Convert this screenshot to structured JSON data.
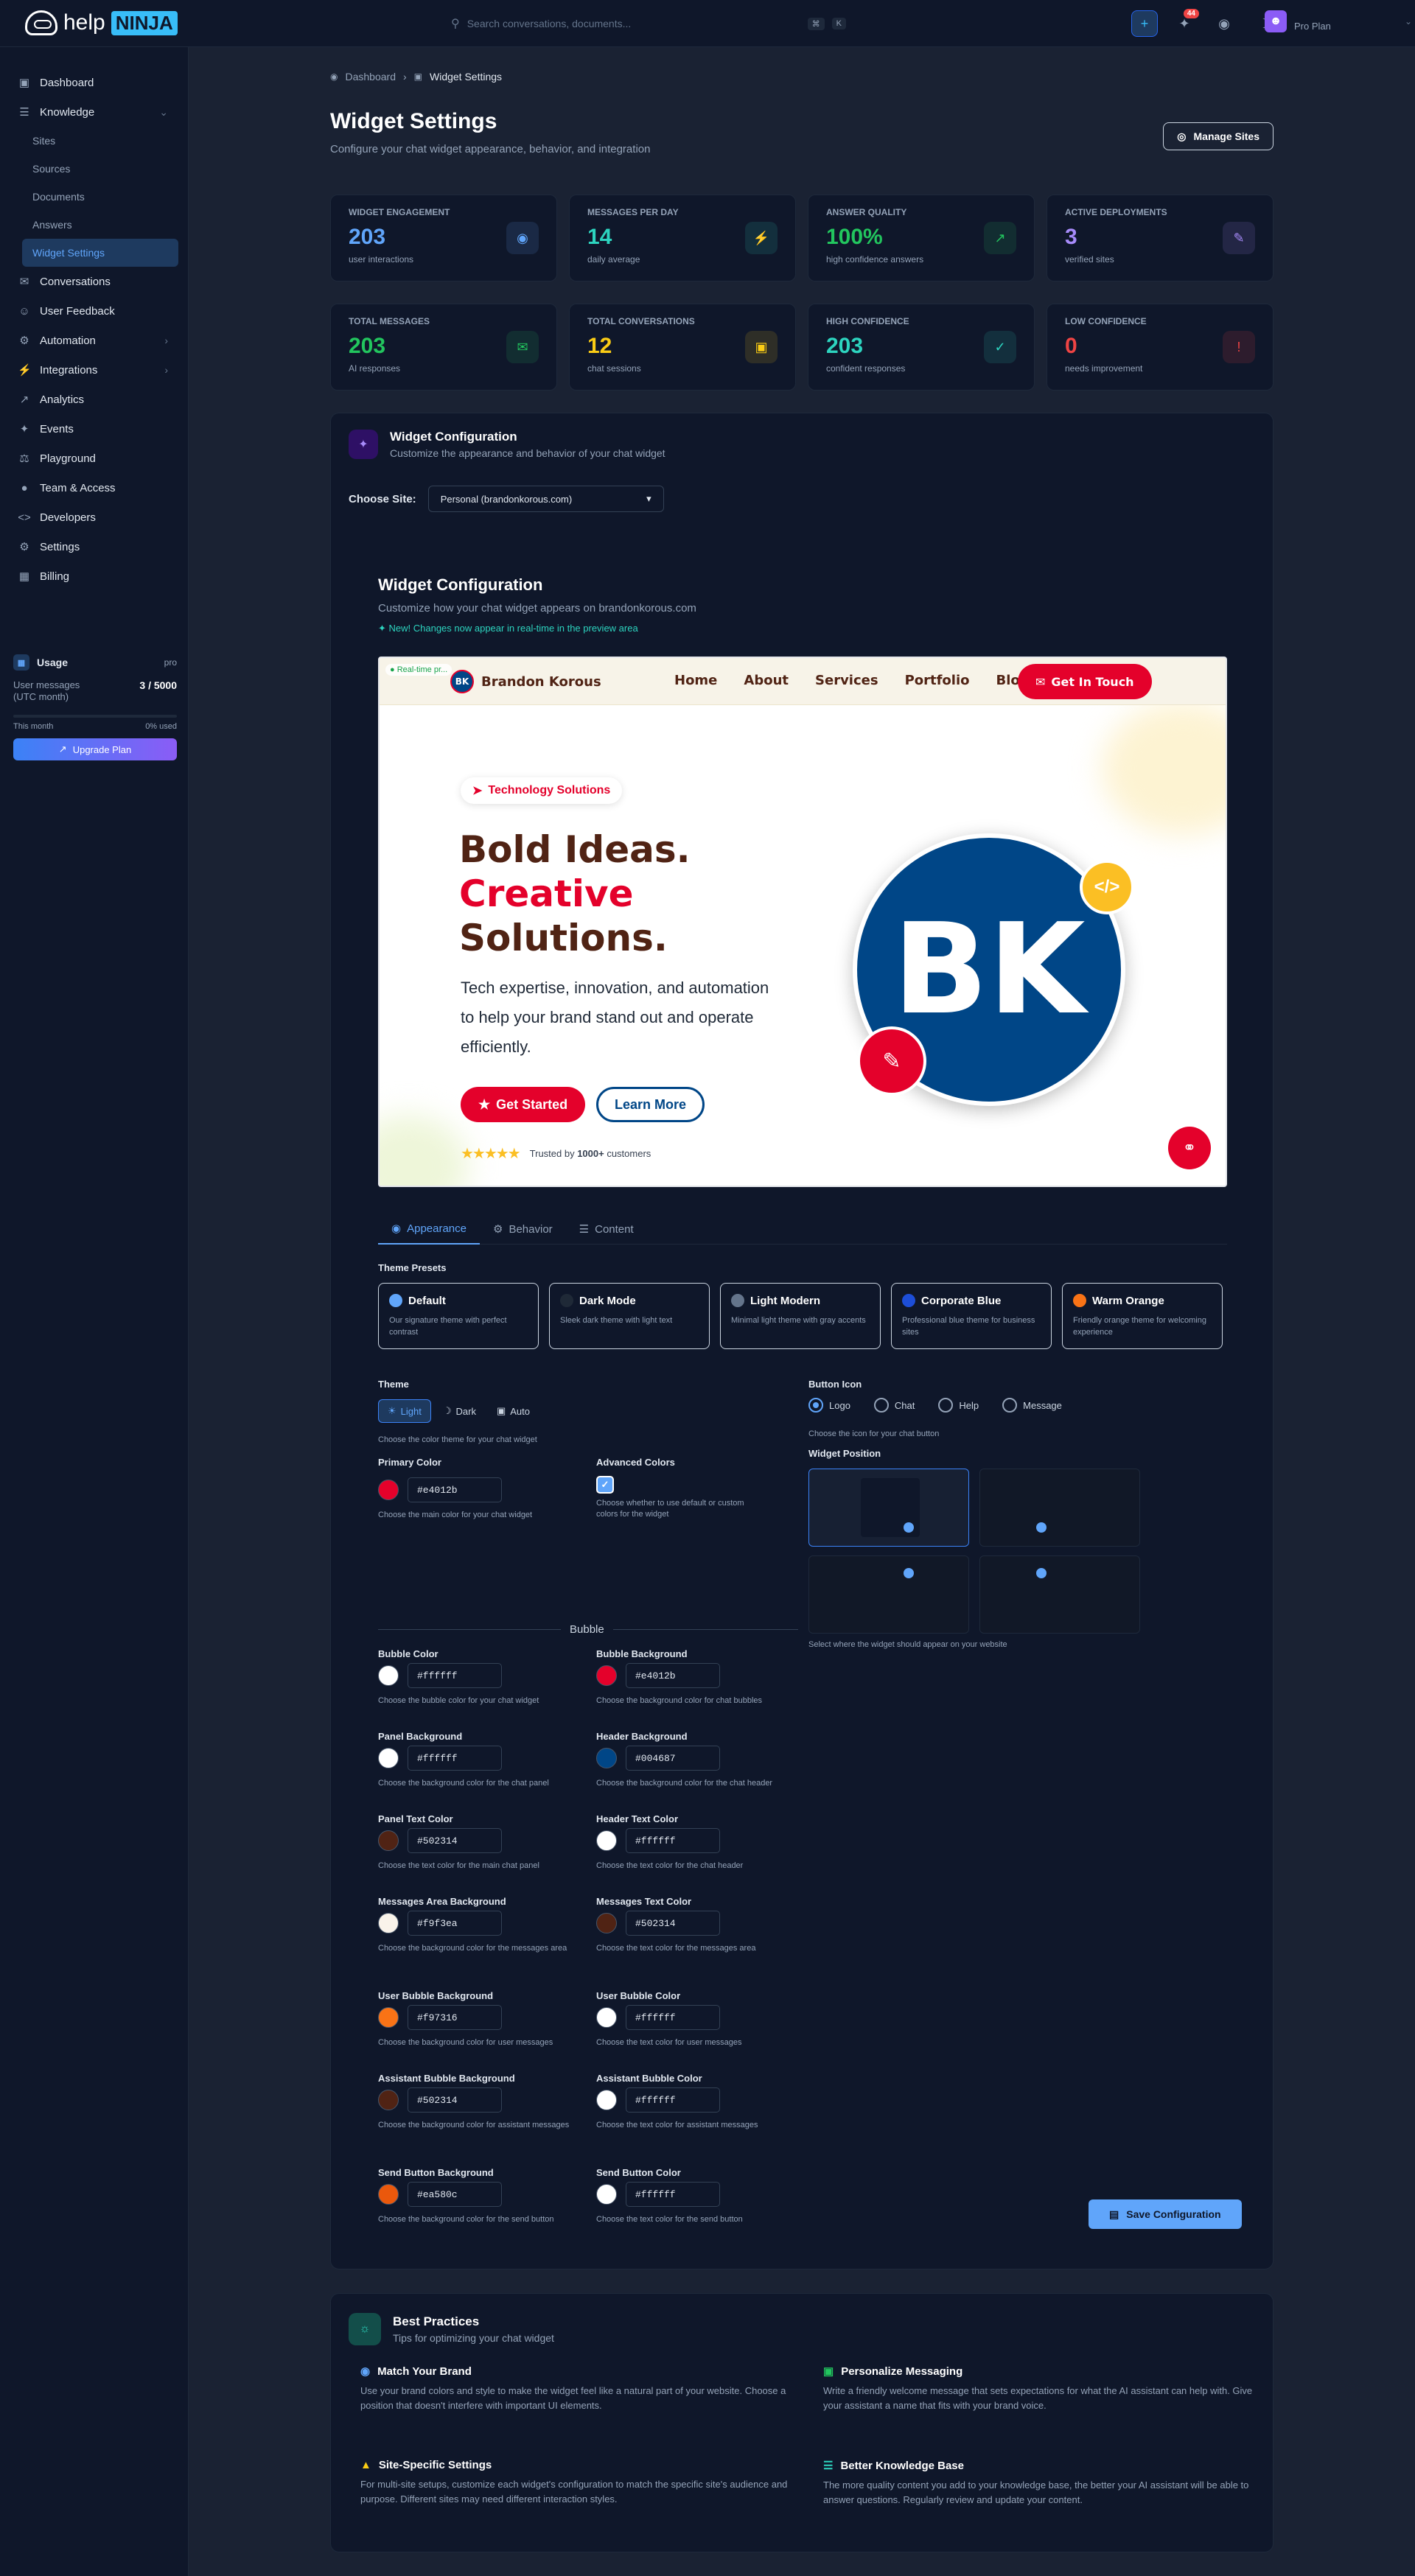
{
  "topbar": {
    "logo_help": "help",
    "logo_ninja": "NINJA",
    "search_placeholder": "Search conversations, documents...",
    "search_kbd": [
      "⌘",
      "K"
    ],
    "notif_count": "44",
    "plan": "Pro Plan"
  },
  "sidebar": {
    "items": [
      {
        "label": "Dashboard",
        "icon": "dashboard-icon"
      },
      {
        "label": "Knowledge",
        "icon": "book-icon",
        "expanded": true
      },
      {
        "label": "Conversations",
        "icon": "chat-icon"
      },
      {
        "label": "User Feedback",
        "icon": "feedback-icon"
      },
      {
        "label": "Automation",
        "icon": "automation-icon"
      },
      {
        "label": "Integrations",
        "icon": "plug-icon"
      },
      {
        "label": "Analytics",
        "icon": "chart-icon"
      },
      {
        "label": "Events",
        "icon": "events-icon"
      },
      {
        "label": "Playground",
        "icon": "flask-icon"
      },
      {
        "label": "Team & Access",
        "icon": "team-icon"
      },
      {
        "label": "Developers",
        "icon": "code-icon"
      },
      {
        "label": "Settings",
        "icon": "gear-icon"
      },
      {
        "label": "Billing",
        "icon": "card-icon"
      }
    ],
    "knowledge_sub": [
      "Sites",
      "Sources",
      "Documents",
      "Answers",
      "Widget Settings"
    ],
    "usage": {
      "title": "Usage",
      "tier": "pro",
      "label": "User messages\n(UTC month)",
      "value": "3 / 5000",
      "period": "This month",
      "pct": "0% used",
      "upgrade": "Upgrade Plan"
    }
  },
  "breadcrumb": {
    "home": "Dashboard",
    "current": "Widget Settings"
  },
  "page": {
    "title": "Widget Settings",
    "subtitle": "Configure your chat widget appearance, behavior, and integration",
    "manage_sites": "Manage Sites"
  },
  "stats": [
    {
      "label": "Widget Engagement",
      "value": "203",
      "sub": "user interactions",
      "color": "#60a5fa"
    },
    {
      "label": "Messages per day",
      "value": "14",
      "sub": "daily average",
      "color": "#2dd4bf"
    },
    {
      "label": "Answer Quality",
      "value": "100%",
      "sub": "high confidence answers",
      "color": "#22c55e"
    },
    {
      "label": "Active Deployments",
      "value": "3",
      "sub": "verified sites",
      "color": "#a78bfa"
    },
    {
      "label": "Total Messages",
      "value": "203",
      "sub": "AI responses",
      "color": "#22c55e"
    },
    {
      "label": "Total Conversations",
      "value": "12",
      "sub": "chat sessions",
      "color": "#facc15"
    },
    {
      "label": "High Confidence",
      "value": "203",
      "sub": "confident responses",
      "color": "#2dd4bf"
    },
    {
      "label": "Low Confidence",
      "value": "0",
      "sub": "needs improvement",
      "color": "#ef4444"
    }
  ],
  "config": {
    "title": "Widget Configuration",
    "subtitle": "Customize the appearance and behavior of your chat widget",
    "choose_site_label": "Choose Site:",
    "site_value": "Personal (brandonkorous.com)",
    "inner_title": "Widget Configuration",
    "inner_subtitle": "Customize how your chat widget appears on brandonkorous.com",
    "inner_new": "New! Changes now appear in real-time in the preview area"
  },
  "preview": {
    "realtime": "Real-time pr...",
    "brand_initials": "BK",
    "brand": "Brandon Korous",
    "links": [
      "Home",
      "About",
      "Services",
      "Portfolio",
      "Blog"
    ],
    "cta": "Get In Touch",
    "pill": "Technology Solutions",
    "h1": "Bold Ideas.",
    "h2": "Creative",
    "h3": "Solutions.",
    "p": "Tech expertise, innovation, and automation to help your brand stand out and operate efficiently.",
    "btn_start": "Get Started",
    "btn_more": "Learn More",
    "trusted_pre": "Trusted by ",
    "trusted_bold": "1000+",
    "trusted_post": " customers",
    "code_glyph": "</>"
  },
  "tabs": [
    "Appearance",
    "Behavior",
    "Content"
  ],
  "presets_label": "Theme Presets",
  "presets": [
    {
      "name": "Default",
      "desc": "Our signature theme with perfect contrast",
      "color": "#60a5fa"
    },
    {
      "name": "Dark Mode",
      "desc": "Sleek dark theme with light text",
      "color": "#1f2937"
    },
    {
      "name": "Light Modern",
      "desc": "Minimal light theme with gray accents",
      "color": "#64748b"
    },
    {
      "name": "Corporate Blue",
      "desc": "Professional blue theme for business sites",
      "color": "#1d4ed8"
    },
    {
      "name": "Warm Orange",
      "desc": "Friendly orange theme for welcoming experience",
      "color": "#f97316"
    }
  ],
  "theme": {
    "label": "Theme",
    "options": [
      "Light",
      "Dark",
      "Auto"
    ],
    "hint": "Choose the color theme for your chat widget"
  },
  "primary": {
    "label": "Primary Color",
    "value": "#e4012b",
    "hint": "Choose the main color for your chat widget"
  },
  "advanced": {
    "label": "Advanced Colors",
    "hint": "Choose whether to use default or custom colors for the widget"
  },
  "bubble_divider": "Bubble",
  "colors": [
    {
      "label": "Bubble Color",
      "value": "#ffffff",
      "hint": "Choose the bubble color for your chat widget"
    },
    {
      "label": "Bubble Background",
      "value": "#e4012b",
      "hint": "Choose the background color for chat bubbles"
    },
    {
      "label": "Panel Background",
      "value": "#ffffff",
      "hint": "Choose the background color for the chat panel"
    },
    {
      "label": "Header Background",
      "value": "#004687",
      "hint": "Choose the background color for the chat header"
    },
    {
      "label": "Panel Text Color",
      "value": "#502314",
      "hint": "Choose the text color for the main chat panel"
    },
    {
      "label": "Header Text Color",
      "value": "#ffffff",
      "hint": "Choose the text color for the chat header"
    },
    {
      "label": "Messages Area Background",
      "value": "#f9f3ea",
      "hint": "Choose the background color for the messages area"
    },
    {
      "label": "Messages Text Color",
      "value": "#502314",
      "hint": "Choose the text color for the messages area"
    },
    {
      "label": "User Bubble Background",
      "value": "#f97316",
      "hint": "Choose the background color for user messages"
    },
    {
      "label": "User Bubble Color",
      "value": "#ffffff",
      "hint": "Choose the text color for user messages"
    },
    {
      "label": "Assistant Bubble Background",
      "value": "#502314",
      "hint": "Choose the background color for assistant messages"
    },
    {
      "label": "Assistant Bubble Color",
      "value": "#ffffff",
      "hint": "Choose the text color for assistant messages"
    },
    {
      "label": "Send Button Background",
      "value": "#ea580c",
      "hint": "Choose the background color for the send button"
    },
    {
      "label": "Send Button Color",
      "value": "#ffffff",
      "hint": "Choose the text color for the send button"
    }
  ],
  "button_icon": {
    "label": "Button Icon",
    "options": [
      "Logo",
      "Chat",
      "Help",
      "Message"
    ],
    "hint": "Choose the icon for your chat button"
  },
  "position": {
    "label": "Widget Position",
    "hint": "Select where the widget should appear on your website"
  },
  "save": "Save Configuration",
  "best": {
    "title": "Best Practices",
    "subtitle": "Tips for optimizing your chat widget",
    "tips": [
      {
        "title": "Match Your Brand",
        "body": "Use your brand colors and style to make the widget feel like a natural part of your website. Choose a position that doesn't interfere with important UI elements.",
        "color": "#60a5fa"
      },
      {
        "title": "Personalize Messaging",
        "body": "Write a friendly welcome message that sets expectations for what the AI assistant can help with. Give your assistant a name that fits with your brand voice.",
        "color": "#22c55e"
      },
      {
        "title": "Site-Specific Settings",
        "body": "For multi-site setups, customize each widget's configuration to match the specific site's audience and purpose. Different sites may need different interaction styles.",
        "color": "#facc15"
      },
      {
        "title": "Better Knowledge Base",
        "body": "The more quality content you add to your knowledge base, the better your AI assistant will be able to answer questions. Regularly review and update your content.",
        "color": "#2dd4bf"
      }
    ]
  }
}
